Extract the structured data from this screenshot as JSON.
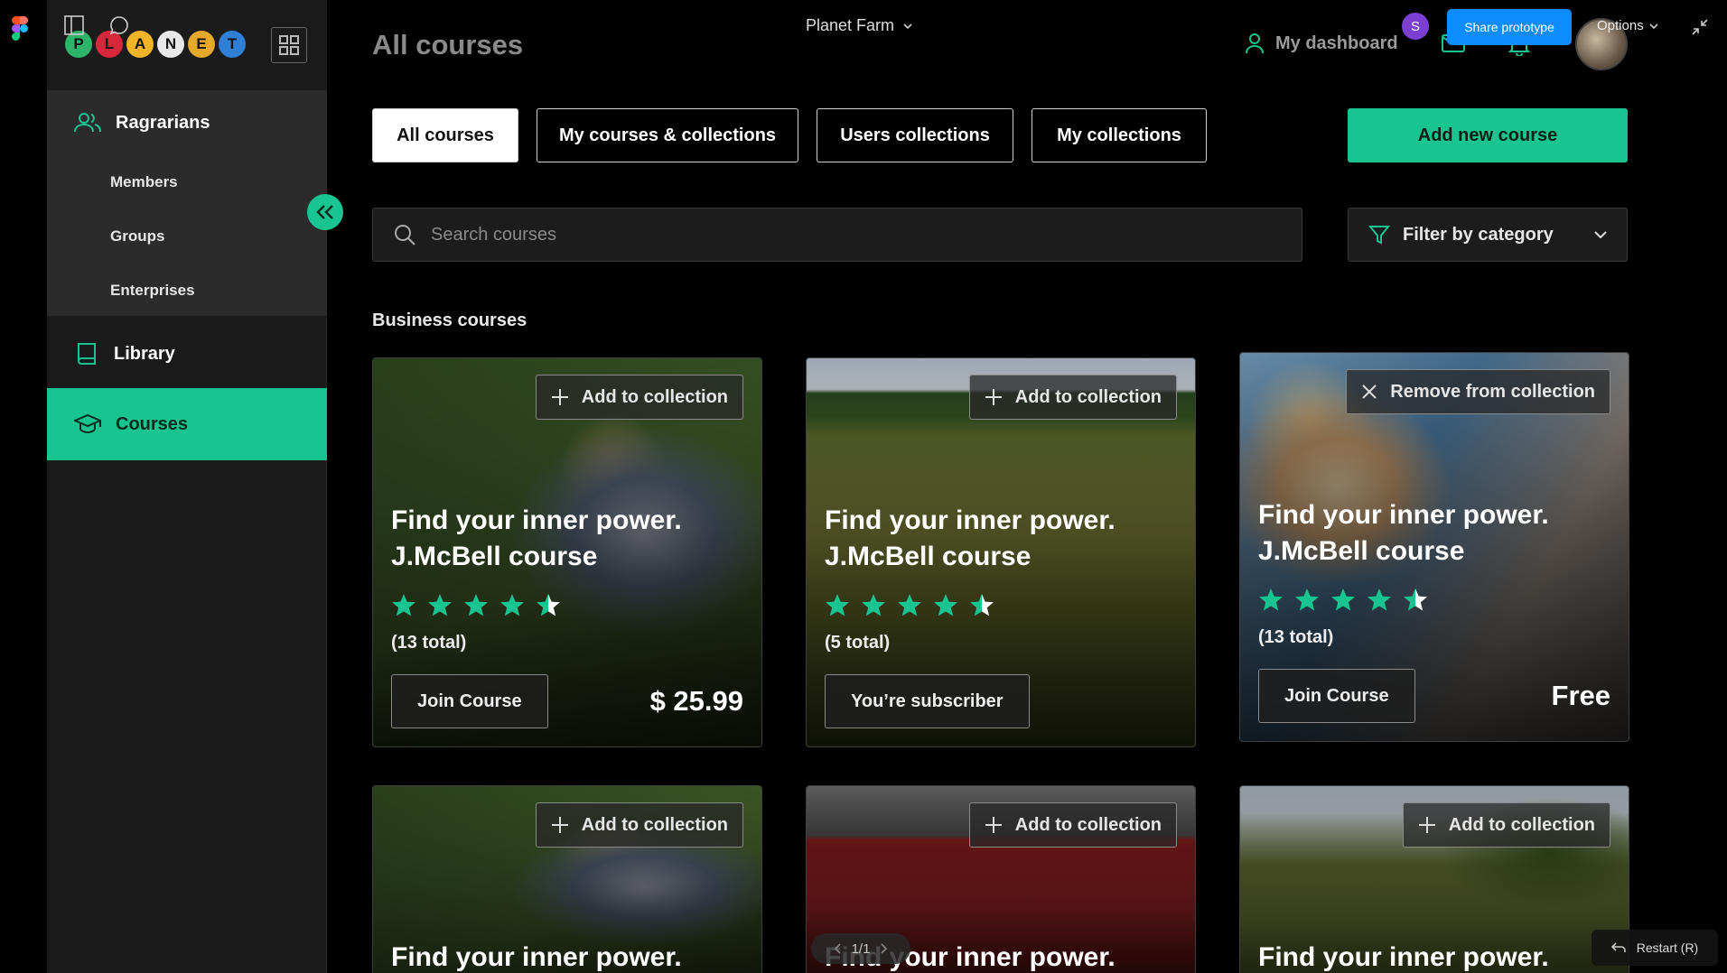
{
  "figma": {
    "project_name": "Planet Farm",
    "collaborator_initial": "S",
    "share_label": "Share prototype",
    "options_label": "Options",
    "pager": "1/1",
    "restart_label": "Restart (R)"
  },
  "brand": {
    "letters": [
      "P",
      "L",
      "A",
      "N",
      "E",
      "T"
    ],
    "accent": "#18c48f"
  },
  "sidebar": {
    "group_label": "Ragrarians",
    "sub_items": [
      "Members",
      "Groups",
      "Enterprises"
    ],
    "library_label": "Library",
    "courses_label": "Courses"
  },
  "header": {
    "title": "All courses",
    "dashboard_label": "My dashboard"
  },
  "tabs": [
    "All courses",
    "My courses & collections",
    "Users collections",
    "My collections"
  ],
  "add_course_label": "Add new course",
  "search": {
    "placeholder": "Search courses"
  },
  "filter_label": "Filter by category",
  "section_title": "Business courses",
  "cards": [
    {
      "collection_action": "Add to collection",
      "title_line1": "Find your inner power.",
      "title_line2": "J.McBell course",
      "rating": 4.5,
      "total": "(13 total)",
      "button": "Join Course",
      "price": "$ 25.99",
      "image": "farmer"
    },
    {
      "collection_action": "Add to collection",
      "title_line1": "Find your inner power.",
      "title_line2": "J.McBell course",
      "rating": 4.5,
      "total": "(5 total)",
      "button": "You’re subscriber",
      "price": "",
      "image": "field"
    },
    {
      "collection_action": "Remove from collection",
      "title_line1": "Find your inner power.",
      "title_line2": "J.McBell course",
      "rating": 4.5,
      "total": "(13 total)",
      "button": "Join Course",
      "price": "Free",
      "image": "traveler"
    },
    {
      "collection_action": "Add to collection",
      "title_line1": "Find your inner power.",
      "image": "farmer"
    },
    {
      "collection_action": "Add to collection",
      "title_line1": "Find your inner power.",
      "image": "barn"
    },
    {
      "collection_action": "Add to collection",
      "title_line1": "Find your inner power.",
      "image": "pasture"
    }
  ]
}
